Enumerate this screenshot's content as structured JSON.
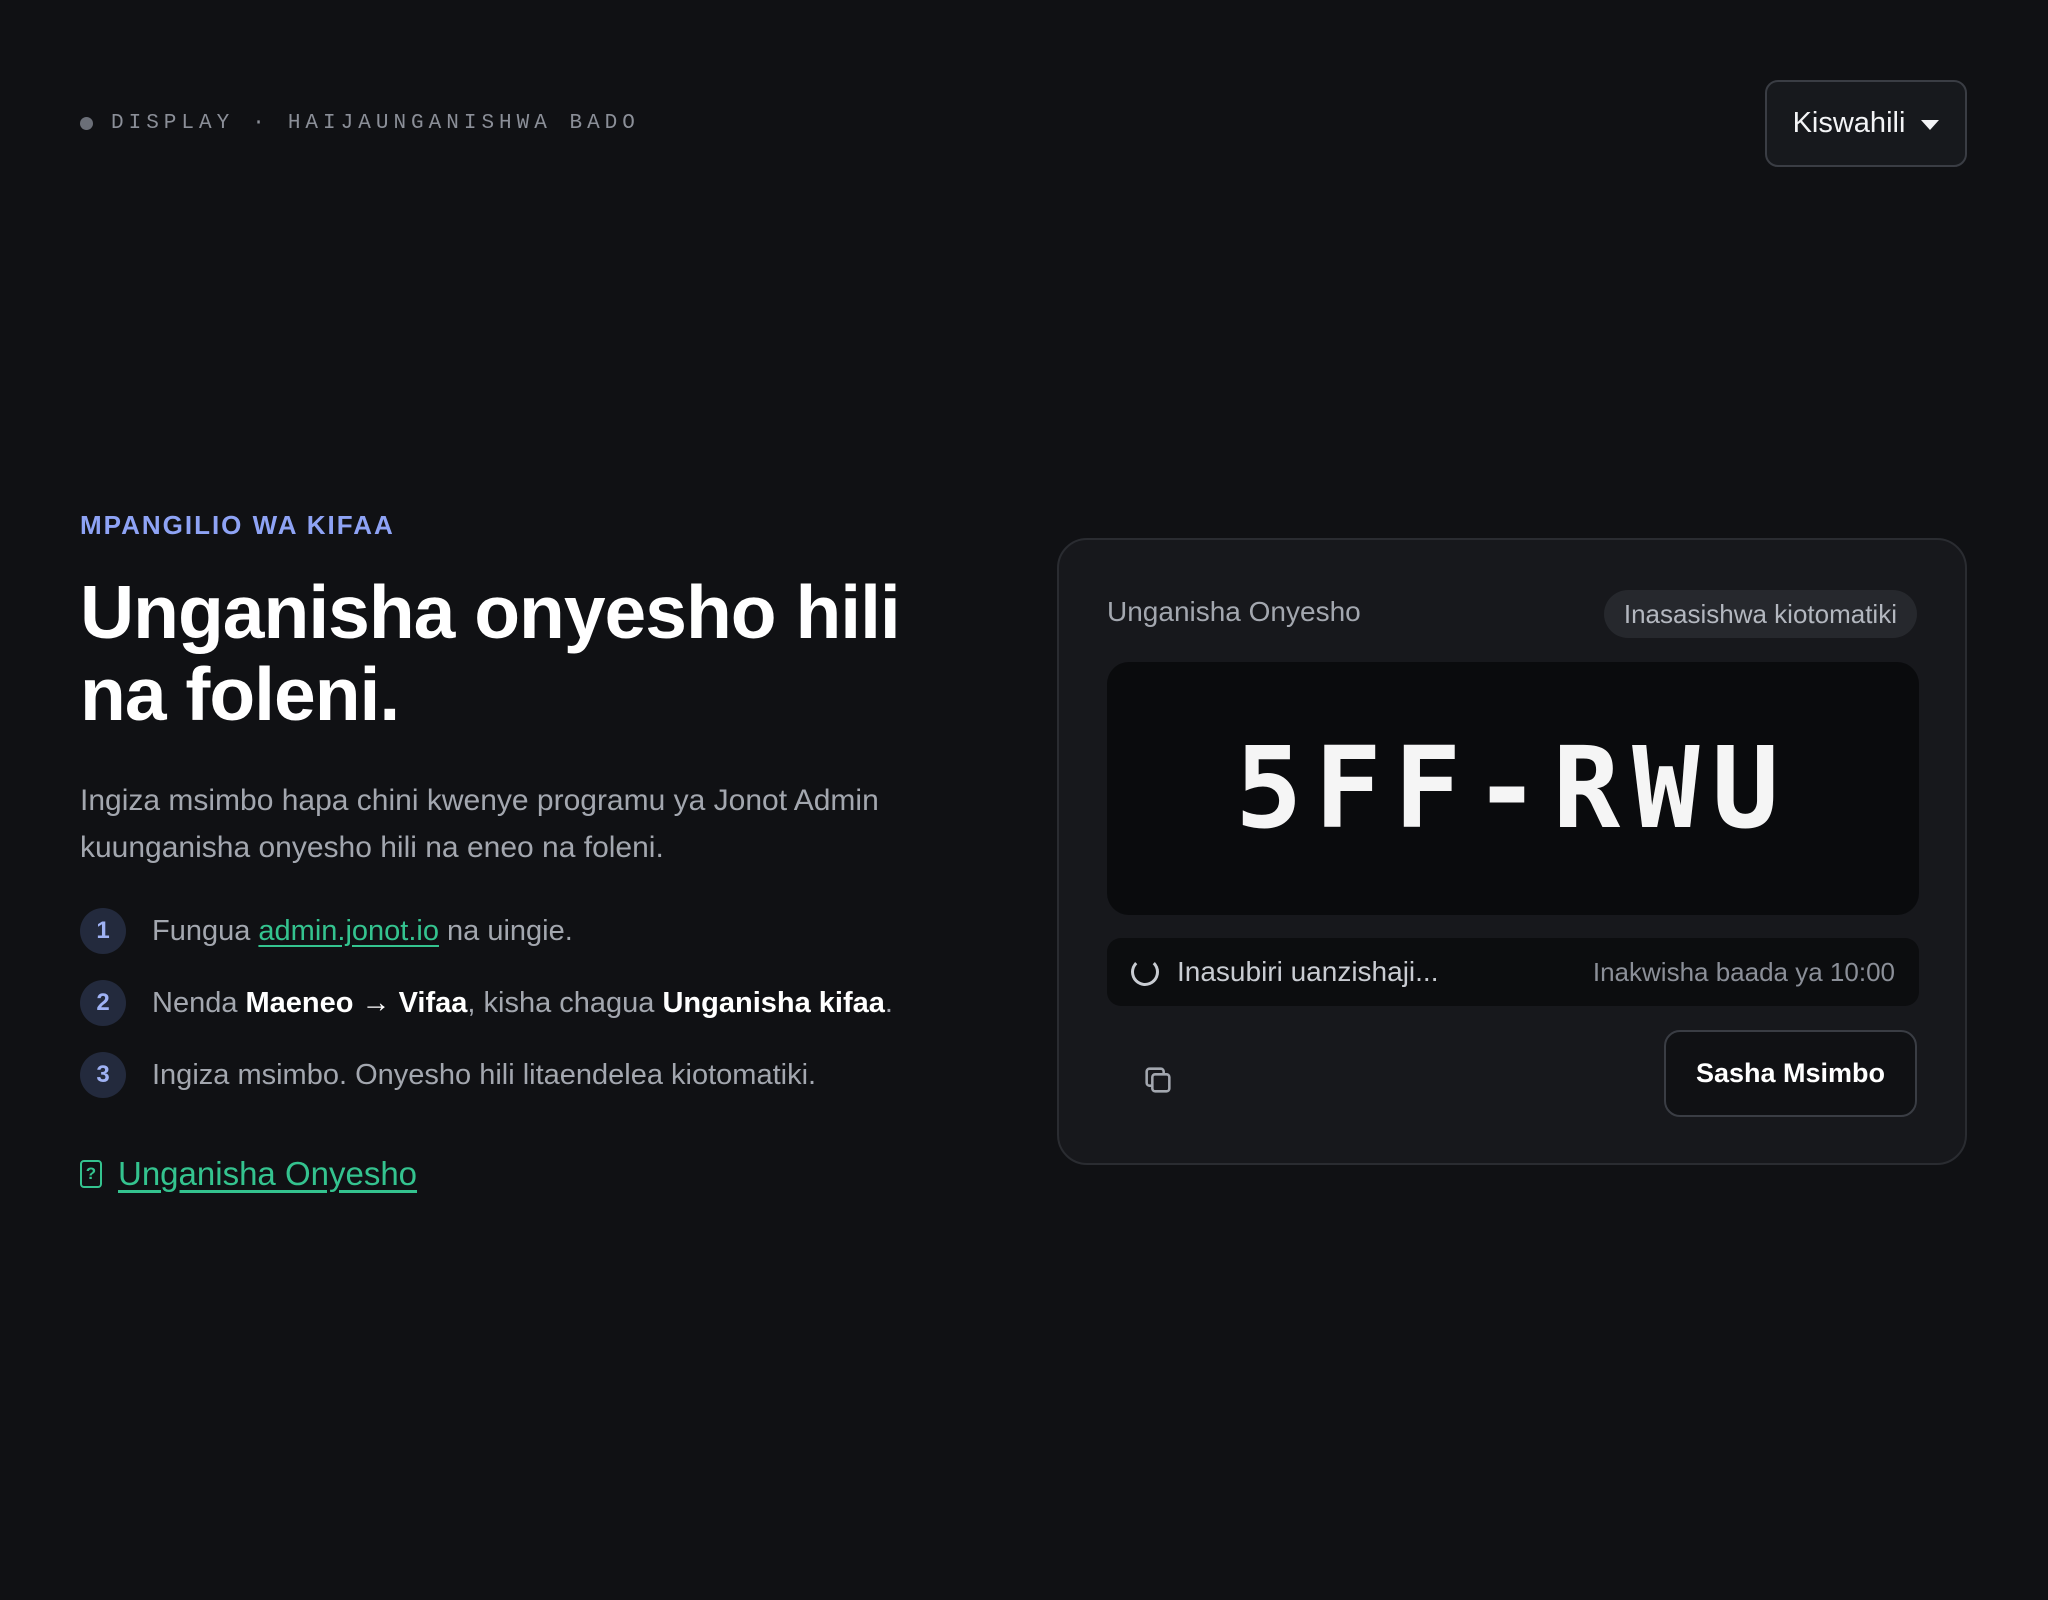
{
  "topbar": {
    "status_device": "DISPLAY",
    "status_separator": "·",
    "status_state": "HAIJAUNGANISHWA BADO",
    "language_label": "Kiswahili"
  },
  "intro": {
    "eyebrow": "MPANGILIO WA KIFAA",
    "headline": "Unganisha onyesho hili na foleni.",
    "lead": "Ingiza msimbo hapa chini kwenye programu ya Jonot Admin kuunganisha onyesho hili na eneo na foleni."
  },
  "steps": [
    {
      "num": "1",
      "pre": "Fungua ",
      "link": "admin.jonot.io",
      "post": " na uingie."
    },
    {
      "num": "2",
      "pre": "Nenda ",
      "bold1": "Maeneo → Vifaa",
      "mid": ", kisha chagua ",
      "bold2": "Unganisha kifaa",
      "post": "."
    },
    {
      "num": "3",
      "text": "Ingiza msimbo. Onyesho hili litaendelea kiotomatiki."
    }
  ],
  "help_link": "Unganisha Onyesho",
  "card": {
    "title": "Unganisha Onyesho",
    "badge": "Inasasishwa kiotomatiki",
    "code": "5FF-RWU",
    "status": "Inasubiri uanzishaji...",
    "expiry": "Inakwisha baada ya 10:00",
    "refresh_label": "Sasha Msimbo",
    "copy_icon": "copy-icon"
  },
  "colors": {
    "background": "#101114",
    "accent_blue": "#8ea3f5",
    "accent_green": "#34c38f",
    "card": "#17181c"
  }
}
